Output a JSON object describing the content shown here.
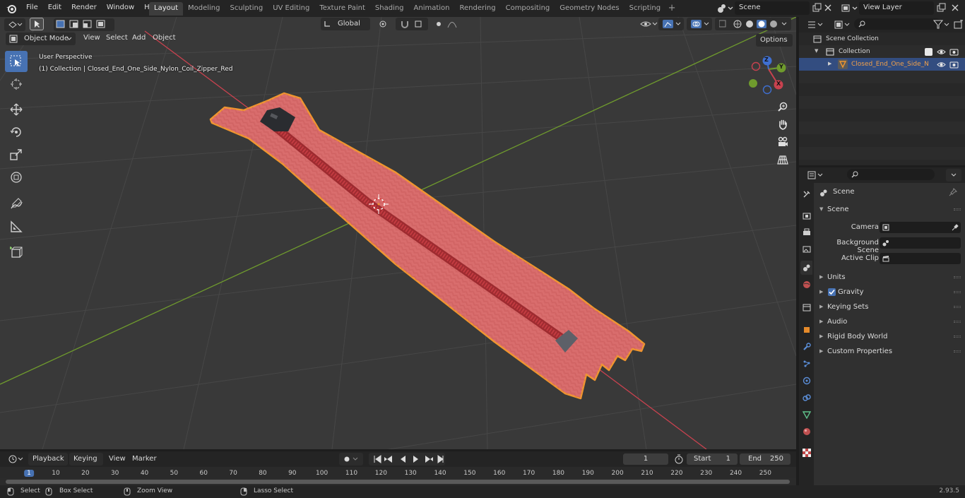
{
  "menu": [
    "File",
    "Edit",
    "Render",
    "Window",
    "Help"
  ],
  "workspaces": [
    "Layout",
    "Modeling",
    "Sculpting",
    "UV Editing",
    "Texture Paint",
    "Shading",
    "Animation",
    "Rendering",
    "Compositing",
    "Geometry Nodes",
    "Scripting"
  ],
  "workspace_add": "+",
  "scene_name": "Scene",
  "view_layer_name": "View Layer",
  "viewport": {
    "transform_orientation": "Global",
    "options_label": "Options",
    "mode": "Object Mode",
    "menus": [
      "View",
      "Select",
      "Add",
      "Object"
    ],
    "perspective_label": "User Perspective",
    "collection_label": "(1) Collection | Closed_End_One_Side_Nylon_Coil_Zipper_Red",
    "gizmo_axes": [
      "Z",
      "Y",
      "X"
    ]
  },
  "timeline": {
    "menus": [
      "Playback",
      "Keying",
      "View",
      "Marker"
    ],
    "current_frame": "1",
    "start_label": "Start",
    "start_value": "1",
    "end_label": "End",
    "end_value": "250",
    "ticks": [
      "1",
      "10",
      "20",
      "30",
      "40",
      "50",
      "60",
      "70",
      "80",
      "90",
      "100",
      "110",
      "120",
      "130",
      "140",
      "150",
      "160",
      "170",
      "180",
      "190",
      "200",
      "210",
      "220",
      "230",
      "240",
      "250"
    ]
  },
  "statusbar": {
    "select": "Select",
    "box_select": "Box Select",
    "zoom_view": "Zoom View",
    "lasso_select": "Lasso Select",
    "version": "2.93.5"
  },
  "outliner": {
    "root": "Scene Collection",
    "collection": "Collection",
    "object": "Closed_End_One_Side_N"
  },
  "properties": {
    "context_title": "Scene",
    "panel_scene": "Scene",
    "camera_label": "Camera",
    "background_scene_label": "Background Scene",
    "active_clip_label": "Active Clip",
    "panels": [
      "Units",
      "Gravity",
      "Keying Sets",
      "Audio",
      "Rigid Body World",
      "Custom Properties"
    ]
  },
  "colors": {
    "accent": "#4772b3",
    "selection_outline": "#f0962e",
    "zipper_fabric": "#d76a6a",
    "axis_x": "#c8424f",
    "axis_y": "#6f9b2d"
  }
}
